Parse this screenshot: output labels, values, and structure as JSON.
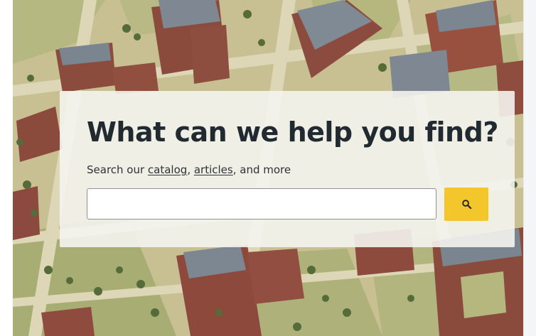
{
  "hero": {
    "image_description_icon": "campus-map-illustration",
    "colors": {
      "panel_background": "#f4f4f0",
      "button_background": "#f3c62b",
      "headline_text": "#222a31"
    }
  },
  "search": {
    "headline": "What can we help you find?",
    "subline_prefix": "Search our ",
    "catalog_link": "catalog",
    "separator": ", ",
    "articles_link": "articles",
    "subline_suffix": ", and more",
    "input_value": "",
    "input_placeholder": "",
    "button_icon": "search-icon"
  }
}
